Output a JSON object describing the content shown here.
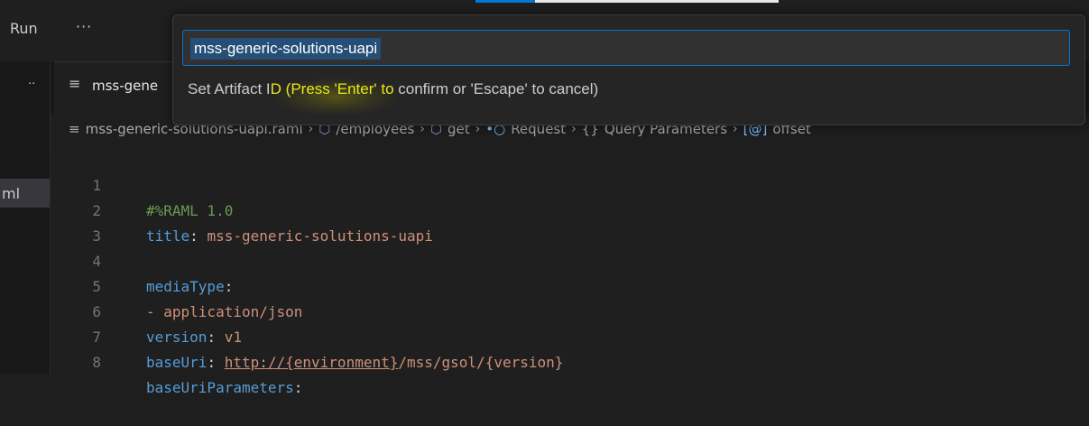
{
  "menu": {
    "run": "Run",
    "more": "···"
  },
  "left_panel": {
    "dots": "··",
    "file_fragment": "ml"
  },
  "tab": {
    "icon": "≡",
    "label": "mss-gene"
  },
  "breadcrumb": {
    "file_icon": "≡",
    "items": [
      {
        "icon": "",
        "label": "mss-generic-solutions-uapi.raml"
      },
      {
        "icon": "⬡",
        "label": "/employees"
      },
      {
        "icon": "⬡",
        "label": "get"
      },
      {
        "icon": "•○",
        "label": "Request"
      },
      {
        "icon": "{}",
        "label": "Query Parameters"
      },
      {
        "icon": "[@]",
        "label": "offset"
      }
    ],
    "separator": "›"
  },
  "editor": {
    "lines": [
      {
        "n": "1",
        "text": "#%RAML 1.0"
      },
      {
        "n": "2",
        "key": "title",
        "value": "mss-generic-solutions-uapi"
      },
      {
        "n": "3",
        "text": ""
      },
      {
        "n": "4",
        "key": "mediaType",
        "value": ""
      },
      {
        "n": "5",
        "value": "- application/json"
      },
      {
        "n": "6",
        "key": "version",
        "value": "v1"
      },
      {
        "n": "7",
        "key": "baseUri",
        "link": "http://{environment}",
        "value": "/mss/gsol/{version}"
      },
      {
        "n": "8",
        "key": "baseUriParameters",
        "value": ""
      }
    ]
  },
  "quickpick": {
    "input_value": "mss-generic-solutions-uapi",
    "message_pre": "Set Artifact I",
    "message_hl1": "D (Press 'Enter' to",
    "message_mid": " confirm or 'Escape' to cancel)"
  },
  "colors": {
    "accent": "#0078d4",
    "selection": "#264f78",
    "highlight": "#e8e817"
  }
}
